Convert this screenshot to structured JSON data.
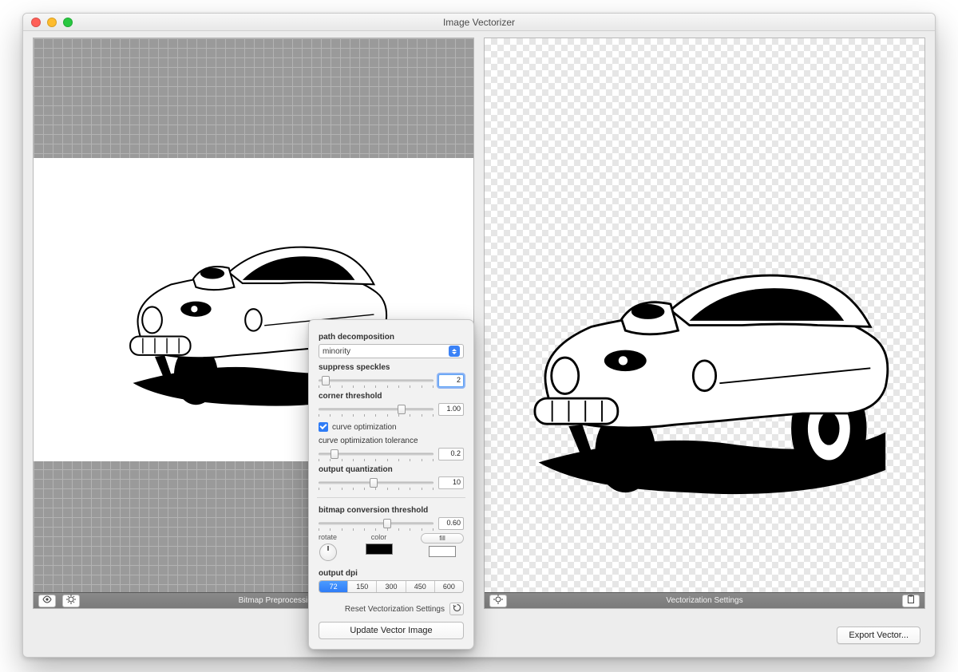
{
  "window": {
    "title": "Image Vectorizer"
  },
  "leftPane": {
    "toolbar_label": "Bitmap Preprocessing"
  },
  "rightPane": {
    "toolbar_label": "Vectorization Settings"
  },
  "export_button": "Export Vector...",
  "popover": {
    "path_decomposition": {
      "label": "path decomposition",
      "value": "minority"
    },
    "suppress_speckles": {
      "label": "suppress speckles",
      "value": "2"
    },
    "corner_threshold": {
      "label": "corner threshold",
      "value": "1.00"
    },
    "curve_optimization": {
      "label": "curve optimization",
      "checked": true
    },
    "curve_opt_tolerance": {
      "label": "curve optimization tolerance",
      "value": "0.2"
    },
    "output_quantization": {
      "label": "output quantization",
      "value": "10"
    },
    "bitmap_conv_threshold": {
      "label": "bitmap conversion threshold",
      "value": "0.60"
    },
    "rotate_label": "rotate",
    "color_label": "color",
    "fill_label": "fill",
    "output_dpi_label": "output dpi",
    "dpi_options": [
      "72",
      "150",
      "300",
      "450",
      "600"
    ],
    "dpi_selected": "72",
    "reset_label": "Reset Vectorization Settings",
    "update_label": "Update Vector Image",
    "colors": {
      "color_swatch": "#000000",
      "fill_swatch": "#ffffff"
    }
  }
}
